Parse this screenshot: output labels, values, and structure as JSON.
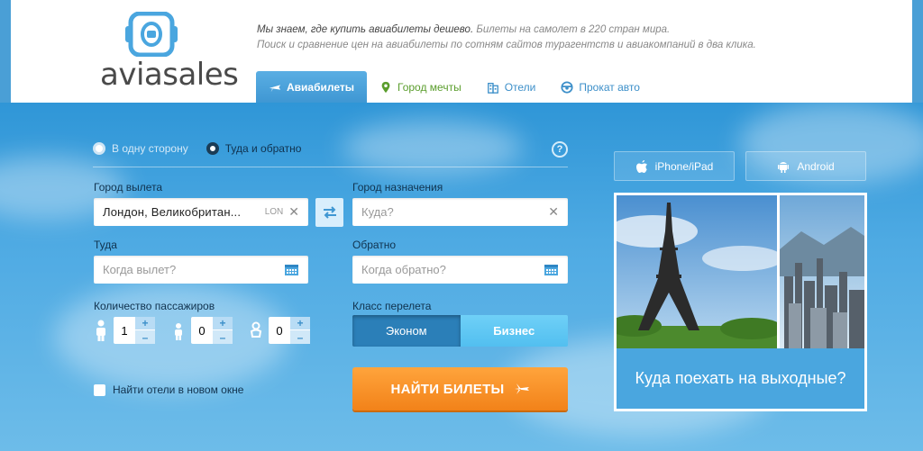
{
  "brand": {
    "name": "aviasales"
  },
  "tagline": {
    "line1_bold": "Мы знаем, где купить авиабилеты дешево.",
    "line1_rest": " Билеты на самолет в 220 стран мира.",
    "line2": "Поиск и сравнение цен на авиабилеты по сотням сайтов турагентств и авиакомпаний в два клика."
  },
  "tabs": [
    {
      "label": "Авиабилеты",
      "icon": "plane-icon",
      "active": true
    },
    {
      "label": "Город мечты",
      "icon": "map-pin-icon",
      "active": false
    },
    {
      "label": "Отели",
      "icon": "building-icon",
      "active": false
    },
    {
      "label": "Прокат авто",
      "icon": "steering-wheel-icon",
      "active": false
    }
  ],
  "trip_type": {
    "one_way": "В одну сторону",
    "round_trip": "Туда и обратно",
    "selected": "round_trip"
  },
  "help": "?",
  "origin": {
    "label": "Город вылета",
    "value": "Лондон, Великобритан...",
    "code": "LON"
  },
  "destination": {
    "label": "Город назначения",
    "placeholder": "Куда?"
  },
  "depart": {
    "label": "Туда",
    "placeholder": "Когда вылет?"
  },
  "return": {
    "label": "Обратно",
    "placeholder": "Когда обратно?"
  },
  "passengers": {
    "label": "Количество пассажиров",
    "adults": "1",
    "children": "0",
    "infants": "0",
    "plus": "+",
    "minus": "–"
  },
  "flight_class": {
    "label": "Класс перелета",
    "economy": "Эконом",
    "business": "Бизнес",
    "selected": "economy"
  },
  "hotels_checkbox": "Найти отели в новом окне",
  "search_button": "НАЙТИ БИЛЕТЫ",
  "apps": {
    "ios": "iPhone/iPad",
    "android": "Android"
  },
  "promo": {
    "text": "Куда поехать на выходные?"
  },
  "colors": {
    "accent": "#3f97d3",
    "cta": "#f28219",
    "sky": "#4eaae3"
  }
}
